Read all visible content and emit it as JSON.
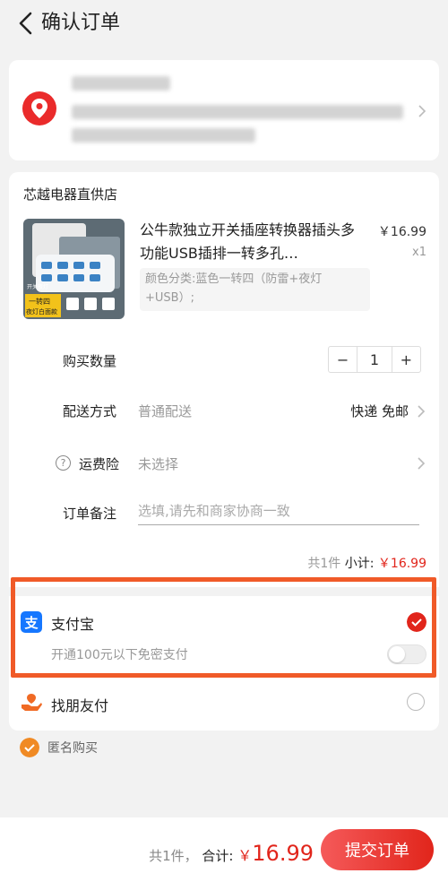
{
  "header": {
    "title": "确认订单"
  },
  "order": {
    "shop_name": "芯越电器直供店",
    "product": {
      "name": "公牛款独立开关插座转换器插头多功能USB插排一转多孔…",
      "price": "￥16.99",
      "quantity_label": "x1",
      "spec": "颜色分类:蓝色一转四（防雷+夜灯+USB）;",
      "thumb_caption_1": "开关夜灯",
      "thumb_caption_2": "一转四",
      "thumb_caption_3": "夜灯白面款"
    },
    "quantity": {
      "label": "购买数量",
      "minus": "−",
      "value": "1",
      "plus": "+"
    },
    "shipping": {
      "label": "配送方式",
      "value": "普通配送",
      "right": "快递 免邮"
    },
    "insurance": {
      "icon_text": "?",
      "label": "运费险",
      "value": "未选择"
    },
    "memo": {
      "label": "订单备注",
      "placeholder": "选填,请先和商家协商一致"
    },
    "subtotal": {
      "count": "共1件",
      "label": "小计:",
      "amount": "￥16.99"
    }
  },
  "payment": {
    "alipay": {
      "icon_text": "支",
      "name": "支付宝",
      "sub": "开通100元以下免密支付",
      "selected": true
    },
    "friend": {
      "name": "找朋友付"
    },
    "anonymous": {
      "label": "匿名购买"
    }
  },
  "footer": {
    "count": "共1件，",
    "total_label": "合计:",
    "yen": "￥",
    "total_amount": "16.99",
    "submit_label": "提交订单"
  },
  "colors": {
    "accent": "#e1251b",
    "highlight": "#f05a28",
    "alipay": "#1677ff"
  }
}
